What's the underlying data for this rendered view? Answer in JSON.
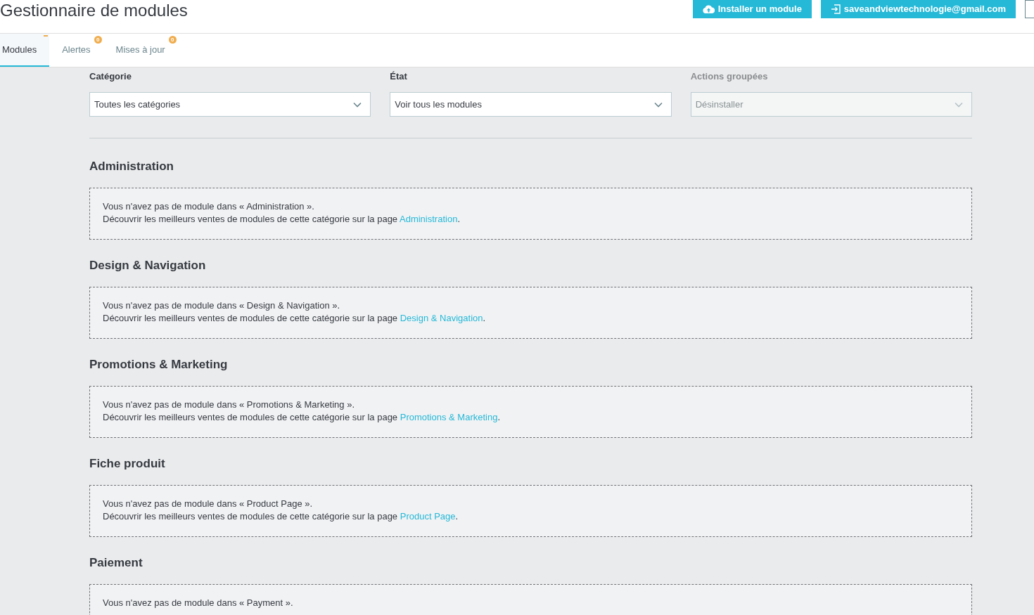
{
  "header": {
    "title": "Gestionnaire de modules",
    "buttons": [
      {
        "kind": "install",
        "label": "Installer un module"
      },
      {
        "kind": "account",
        "label": "saveandviewtechnologie@gmail.com"
      }
    ]
  },
  "tabs": [
    {
      "label": "Modules",
      "selected": true,
      "indicator": true
    },
    {
      "label": "Alertes",
      "selected": false,
      "indicator": false,
      "badge": "0"
    },
    {
      "label": "Mises à jour",
      "selected": false,
      "indicator": false,
      "badge": "0"
    }
  ],
  "filters": [
    {
      "label": "Catégorie",
      "value": "Toutes les catégories",
      "disabled": false
    },
    {
      "label": "État",
      "value": "Voir tous les modules",
      "disabled": false
    },
    {
      "label": "Actions groupées",
      "value": "Désinstaller",
      "disabled": true
    }
  ],
  "sections": [
    {
      "title": "Administration",
      "message": "Vous n'avez pas de module dans « Administration ».",
      "discover": {
        "before": "Découvrir les meilleurs ventes de modules de cette catégorie sur la page ",
        "link": "Administration",
        "after": "."
      }
    },
    {
      "title": "Design & Navigation",
      "message": "Vous n'avez pas de module dans « Design & Navigation ».",
      "discover": {
        "before": "Découvrir les meilleurs ventes de modules de cette catégorie sur la page ",
        "link": "Design & Navigation",
        "after": "."
      }
    },
    {
      "title": "Promotions & Marketing",
      "message": "Vous n'avez pas de module dans « Promotions & Marketing ».",
      "discover": {
        "before": "Découvrir les meilleurs ventes de modules de cette catégorie sur la page ",
        "link": "Promotions & Marketing",
        "after": "."
      }
    },
    {
      "title": "Fiche produit",
      "message": "Vous n'avez pas de module dans « Product Page ».",
      "discover": {
        "before": "Découvrir les meilleurs ventes de modules de cette catégorie sur la page ",
        "link": "Product Page",
        "after": "."
      }
    },
    {
      "title": "Paiement",
      "message": "Vous n'avez pas de module dans « Payment »."
    }
  ]
}
